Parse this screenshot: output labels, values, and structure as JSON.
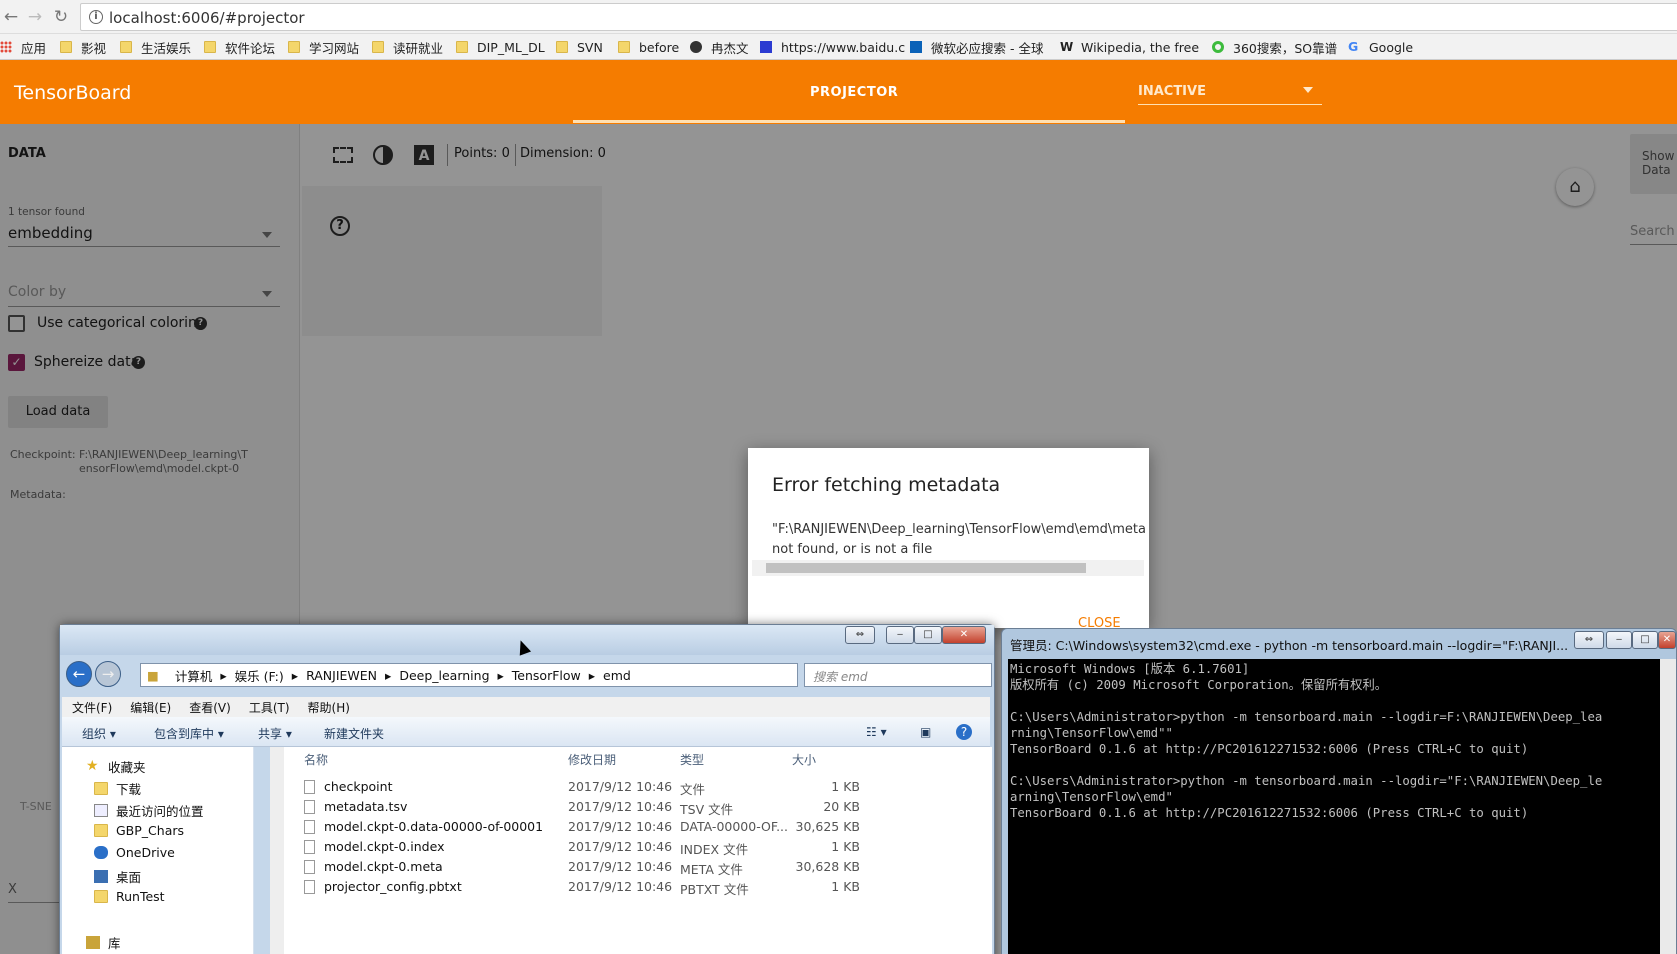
{
  "browser": {
    "url": "localhost:6006/#projector",
    "bookmarks": [
      "应用",
      "影视",
      "生活娱乐",
      "软件论坛",
      "学习网站",
      "读研就业",
      "DIP_ML_DL",
      "SVN",
      "before",
      "冉杰文",
      "https://www.baidu.c",
      "微软必应搜索 - 全球",
      "Wikipedia, the free",
      "360搜索，SO靠谱",
      "Google"
    ]
  },
  "tensorboard": {
    "logo": "TensorBoard",
    "tab": "PROJECTOR",
    "run_select": "INACTIVE",
    "data_heading": "DATA",
    "tensor_found": "1 tensor found",
    "tensor_value": "embedding",
    "color_by": "Color by",
    "categorical": "Use categorical coloring",
    "sphereize": "Sphereize data",
    "load_button": "Load data",
    "checkpoint_label": "Checkpoint:",
    "checkpoint_path_1": "F:\\RANJIEWEN\\Deep_learning\\T",
    "checkpoint_path_2": "ensorFlow\\emd\\model.ckpt-0",
    "metadata_label": "Metadata:",
    "points": "Points: 0",
    "dimension": "Dimension: 0",
    "show_data_1": "Show",
    "show_data_2": "Data",
    "search": "Search",
    "tsne": "T-SNE",
    "x_label": "X"
  },
  "dialog": {
    "title": "Error fetching metadata",
    "msg_1": "\"F:\\RANJIEWEN\\Deep_learning\\TensorFlow\\emd\\emd\\meta",
    "msg_2": "not found, or is not a file",
    "close": "CLOSE"
  },
  "explorer": {
    "breadcrumbs": [
      "计算机",
      "娱乐 (F:)",
      "RANJIEWEN",
      "Deep_learning",
      "TensorFlow",
      "emd"
    ],
    "search_placeholder": "搜索 emd",
    "menus": [
      "文件(F)",
      "编辑(E)",
      "查看(V)",
      "工具(T)",
      "帮助(H)"
    ],
    "commands": [
      "组织 ▾",
      "包含到库中 ▾",
      "共享 ▾",
      "新建文件夹"
    ],
    "nav": [
      "收藏夹",
      "下载",
      "最近访问的位置",
      "GBP_Chars",
      "OneDrive",
      "桌面",
      "RunTest",
      "库"
    ],
    "columns": [
      "名称",
      "修改日期",
      "类型",
      "大小"
    ],
    "files": [
      {
        "name": "checkpoint",
        "date": "2017/9/12 10:46",
        "type": "文件",
        "size": "1 KB"
      },
      {
        "name": "metadata.tsv",
        "date": "2017/9/12 10:46",
        "type": "TSV 文件",
        "size": "20 KB"
      },
      {
        "name": "model.ckpt-0.data-00000-of-00001",
        "date": "2017/9/12 10:46",
        "type": "DATA-00000-OF...",
        "size": "30,625 KB"
      },
      {
        "name": "model.ckpt-0.index",
        "date": "2017/9/12 10:46",
        "type": "INDEX 文件",
        "size": "1 KB"
      },
      {
        "name": "model.ckpt-0.meta",
        "date": "2017/9/12 10:46",
        "type": "META 文件",
        "size": "30,628 KB"
      },
      {
        "name": "projector_config.pbtxt",
        "date": "2017/9/12 10:46",
        "type": "PBTXT 文件",
        "size": "1 KB"
      }
    ]
  },
  "cmd": {
    "title": "管理员: C:\\Windows\\system32\\cmd.exe - python  -m tensorboard.main --logdir=\"F:\\RANJI...",
    "lines": [
      "Microsoft Windows [版本 6.1.7601]",
      "版权所有 (c) 2009 Microsoft Corporation。保留所有权利。",
      "",
      "C:\\Users\\Administrator>python -m tensorboard.main --logdir=F:\\RANJIEWEN\\Deep_lea",
      "rning\\TensorFlow\\emd\"\"",
      "TensorBoard 0.1.6 at http://PC201612271532:6006 (Press CTRL+C to quit)",
      "",
      "C:\\Users\\Administrator>python -m tensorboard.main --logdir=\"F:\\RANJIEWEN\\Deep_le",
      "arning\\TensorFlow\\emd\"",
      "TensorBoard 0.1.6 at http://PC201612271532:6006 (Press CTRL+C to quit)"
    ]
  }
}
